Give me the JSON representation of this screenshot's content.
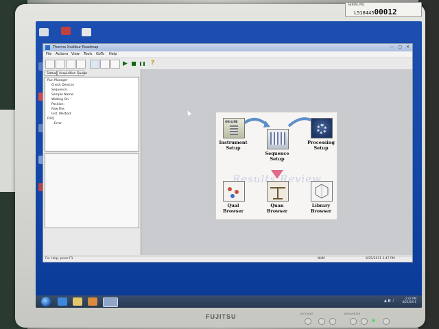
{
  "monitor": {
    "brand": "FUJITSU",
    "serial_top": "SERIAL NO.",
    "serial_prefix": "L518445",
    "serial_number": "00012",
    "button_labels": [
      "AUTO/EXIT",
      "MENU/ENTER"
    ],
    "power_led_color": "#2fdc45"
  },
  "window": {
    "title": "Thermo Xcalibur Roadmap",
    "menu": [
      "File",
      "Actions",
      "View",
      "Tools",
      "GoTo",
      "Help"
    ]
  },
  "left_pane": {
    "tabs": [
      "Status",
      "Acquisition Queue"
    ],
    "tree": [
      "Run Manager",
      "Check Devices",
      "Sequence:",
      "Sample Name:",
      "Waiting On:",
      "Position:",
      "Raw File:",
      "Inst. Method:",
      "DSQ",
      "Error"
    ]
  },
  "roadmap": {
    "watermark": "Results Review",
    "items": {
      "instrument_setup": [
        "Instrument",
        "Setup"
      ],
      "sequence_setup": [
        "Sequence",
        "Setup"
      ],
      "processing_setup": [
        "Processing",
        "Setup"
      ],
      "qual_browser": [
        "Qual",
        "Browser"
      ],
      "quan_browser": [
        "Quan",
        "Browser"
      ],
      "library_browser": [
        "Library",
        "Browser"
      ]
    },
    "instrument_icon_text": "ON-LINE"
  },
  "statusbar": {
    "help_text": "For Help, press F1",
    "mode": "NUM",
    "datetime": "8/25/2011  2:47 PM"
  },
  "taskbar": {
    "time": "2:47 PM",
    "date": "8/25/2011"
  },
  "colors": {
    "desktop": "#1246a8",
    "accent": "#116611"
  }
}
